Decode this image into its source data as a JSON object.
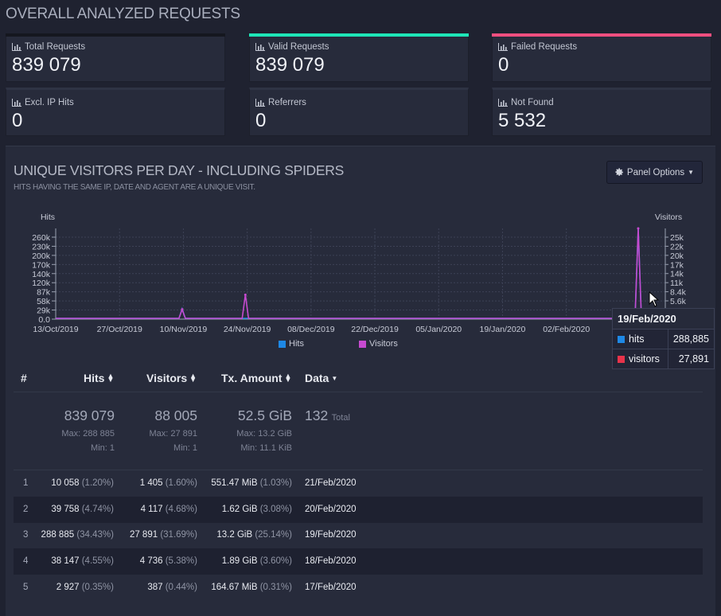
{
  "page_title": "OVERALL ANALYZED REQUESTS",
  "cards": [
    {
      "label": "Total Requests",
      "value": "839 079",
      "accent": "#15171f"
    },
    {
      "label": "Valid Requests",
      "value": "839 079",
      "accent": "#1ee6b8"
    },
    {
      "label": "Failed Requests",
      "value": "0",
      "accent": "#ef4f7f"
    },
    {
      "label": "Excl. IP Hits",
      "value": "0",
      "accent": ""
    },
    {
      "label": "Referrers",
      "value": "0",
      "accent": ""
    },
    {
      "label": "Not Found",
      "value": "5 532",
      "accent": ""
    }
  ],
  "panel": {
    "title": "UNIQUE VISITORS PER DAY - INCLUDING SPIDERS",
    "subtitle": "HITS HAVING THE SAME IP, DATE AND AGENT ARE A UNIQUE VISIT.",
    "options_button": "Panel Options",
    "options_icon": "gear-icon"
  },
  "chart_data": {
    "type": "line",
    "left_axis_label": "Hits",
    "right_axis_label": "Visitors",
    "left_ticks": [
      "260k",
      "230k",
      "200k",
      "170k",
      "140k",
      "120k",
      "87k",
      "58k",
      "29k",
      "0.0"
    ],
    "right_ticks": [
      "25k",
      "22k",
      "20k",
      "17k",
      "14k",
      "11k",
      "8.4k",
      "5.6k"
    ],
    "x_ticks": [
      "13/Oct/2019",
      "27/Oct/2019",
      "10/Nov/2019",
      "24/Nov/2019",
      "08/Dec/2019",
      "22/Dec/2019",
      "05/Jan/2020",
      "19/Jan/2020",
      "02/Feb/2020"
    ],
    "series": [
      {
        "name": "Hits",
        "color": "#1e88e5"
      },
      {
        "name": "Visitors",
        "color": "#c64ad0"
      }
    ],
    "hits_ylim": [
      0,
      289000
    ],
    "x_span_days": 132,
    "peaks": [
      {
        "date": "10/Nov/2019",
        "hits": 33000,
        "visitors": 3000
      },
      {
        "date": "24/Nov/2019",
        "hits": 0,
        "visitors": 7500
      },
      {
        "date": "19/Feb/2020",
        "hits": 288885,
        "visitors": 27891
      }
    ],
    "tooltip": {
      "date": "19/Feb/2020",
      "rows": [
        {
          "label": "hits",
          "value": "288,885",
          "color": "#1e88e5"
        },
        {
          "label": "visitors",
          "value": "27,891",
          "color": "#e8334a"
        }
      ]
    }
  },
  "table": {
    "headers": {
      "num": "#",
      "hits": "Hits",
      "visitors": "Visitors",
      "tx": "Tx. Amount",
      "data": "Data"
    },
    "summary": {
      "hits": {
        "total": "839 079",
        "max": "Max: 288 885",
        "min": "Min: 1"
      },
      "visitors": {
        "total": "88 005",
        "max": "Max: 27 891",
        "min": "Min: 1"
      },
      "tx": {
        "total": "52.5 GiB",
        "max": "Max: 13.2 GiB",
        "min": "Min: 11.1 KiB"
      },
      "data": {
        "total": "132",
        "label": "Total"
      }
    },
    "rows": [
      {
        "n": "1",
        "hits": "10 058",
        "hits_pct": "(1.20%)",
        "visitors": "1 405",
        "visitors_pct": "(1.60%)",
        "tx": "551.47 MiB",
        "tx_pct": "(1.03%)",
        "date": "21/Feb/2020"
      },
      {
        "n": "2",
        "hits": "39 758",
        "hits_pct": "(4.74%)",
        "visitors": "4 117",
        "visitors_pct": "(4.68%)",
        "tx": "1.62 GiB",
        "tx_pct": "(3.08%)",
        "date": "20/Feb/2020"
      },
      {
        "n": "3",
        "hits": "288 885",
        "hits_pct": "(34.43%)",
        "visitors": "27 891",
        "visitors_pct": "(31.69%)",
        "tx": "13.2 GiB",
        "tx_pct": "(25.14%)",
        "date": "19/Feb/2020"
      },
      {
        "n": "4",
        "hits": "38 147",
        "hits_pct": "(4.55%)",
        "visitors": "4 736",
        "visitors_pct": "(5.38%)",
        "tx": "1.89 GiB",
        "tx_pct": "(3.60%)",
        "date": "18/Feb/2020"
      },
      {
        "n": "5",
        "hits": "2 927",
        "hits_pct": "(0.35%)",
        "visitors": "387",
        "visitors_pct": "(0.44%)",
        "tx": "164.67 MiB",
        "tx_pct": "(0.31%)",
        "date": "17/Feb/2020"
      }
    ]
  }
}
